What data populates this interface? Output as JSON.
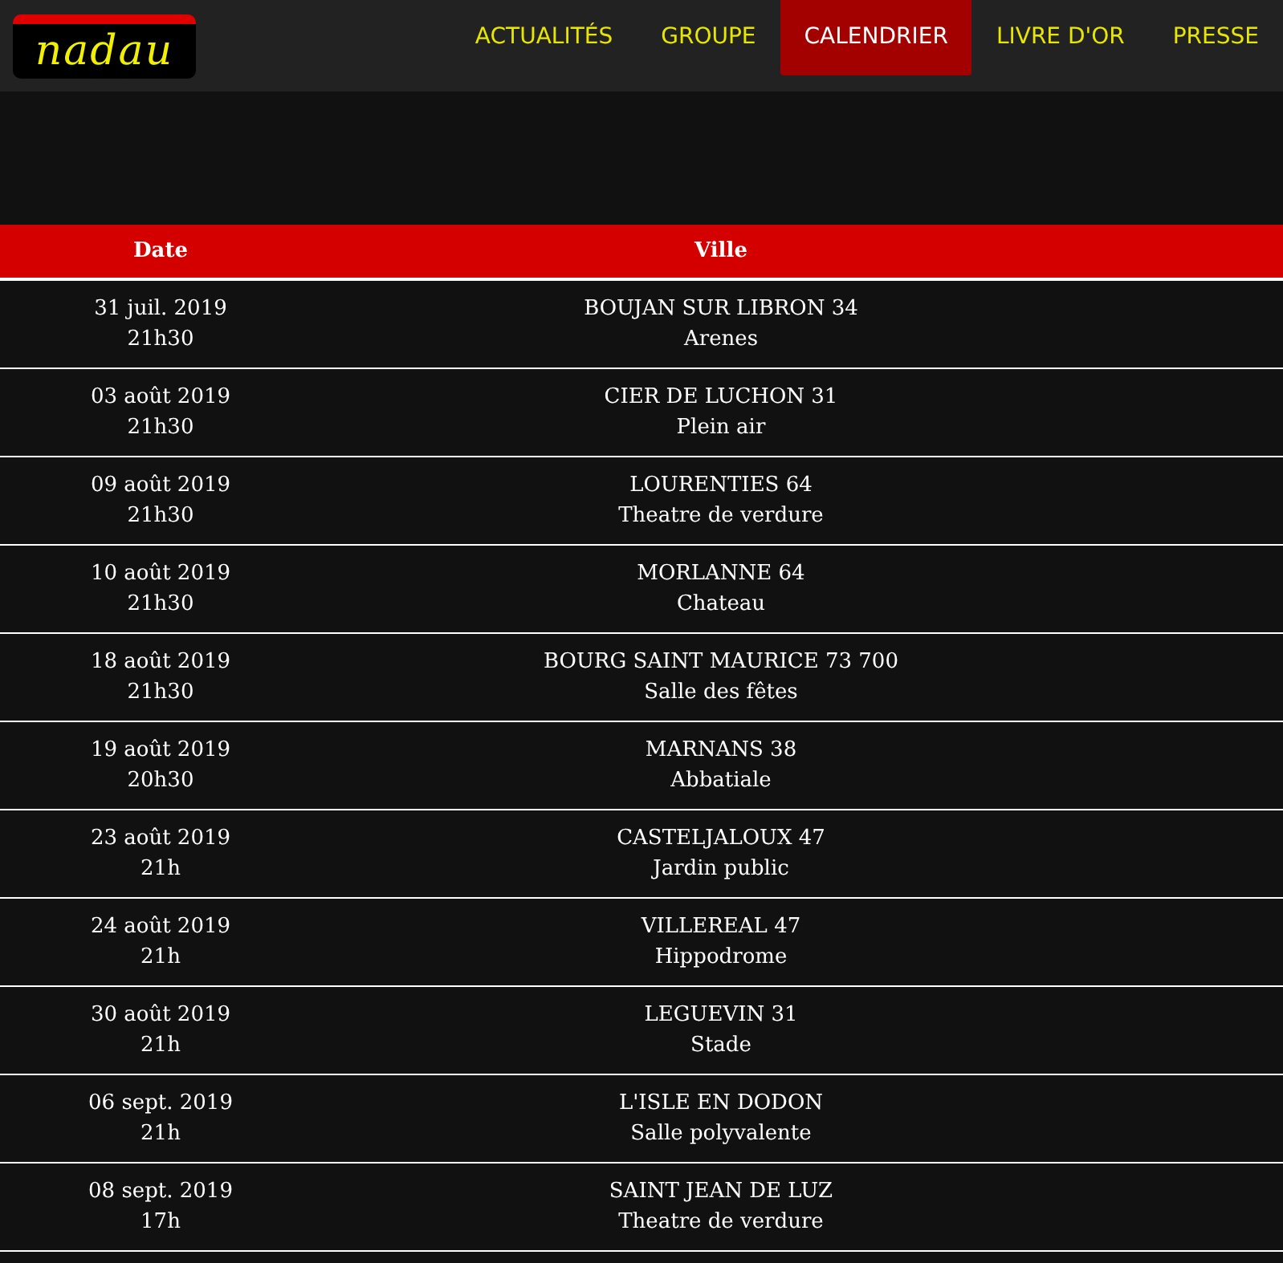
{
  "logo": "nadau",
  "nav": [
    {
      "label": "ACTUALITÉS",
      "selected": false
    },
    {
      "label": "GROUPE",
      "selected": false
    },
    {
      "label": "CALENDRIER",
      "selected": true
    },
    {
      "label": "LIVRE D'OR",
      "selected": false
    },
    {
      "label": "PRESSE",
      "selected": false
    }
  ],
  "table": {
    "columns": [
      "Date",
      "Ville"
    ],
    "rows": [
      {
        "date": "31 juil. 2019",
        "time": "21h30",
        "city": "BOUJAN SUR LIBRON 34",
        "venue": "Arenes"
      },
      {
        "date": "03 août 2019",
        "time": "21h30",
        "city": "CIER DE LUCHON 31",
        "venue": "Plein air"
      },
      {
        "date": "09 août 2019",
        "time": "21h30",
        "city": "LOURENTIES 64",
        "venue": "Theatre de verdure"
      },
      {
        "date": "10 août 2019",
        "time": "21h30",
        "city": "MORLANNE 64",
        "venue": "Chateau"
      },
      {
        "date": "18 août 2019",
        "time": "21h30",
        "city": "BOURG SAINT MAURICE 73 700",
        "venue": "Salle des fêtes"
      },
      {
        "date": "19 août 2019",
        "time": "20h30",
        "city": "MARNANS 38",
        "venue": "Abbatiale"
      },
      {
        "date": "23 août 2019",
        "time": "21h",
        "city": "CASTELJALOUX 47",
        "venue": "Jardin public"
      },
      {
        "date": "24 août 2019",
        "time": "21h",
        "city": "VILLEREAL 47",
        "venue": "Hippodrome"
      },
      {
        "date": "30 août 2019",
        "time": "21h",
        "city": "LEGUEVIN 31",
        "venue": "Stade"
      },
      {
        "date": "06 sept. 2019",
        "time": "21h",
        "city": "L'ISLE EN DODON",
        "venue": "Salle polyvalente"
      },
      {
        "date": "08 sept. 2019",
        "time": "17h",
        "city": "SAINT JEAN DE LUZ",
        "venue": "Theatre de verdure"
      }
    ]
  }
}
